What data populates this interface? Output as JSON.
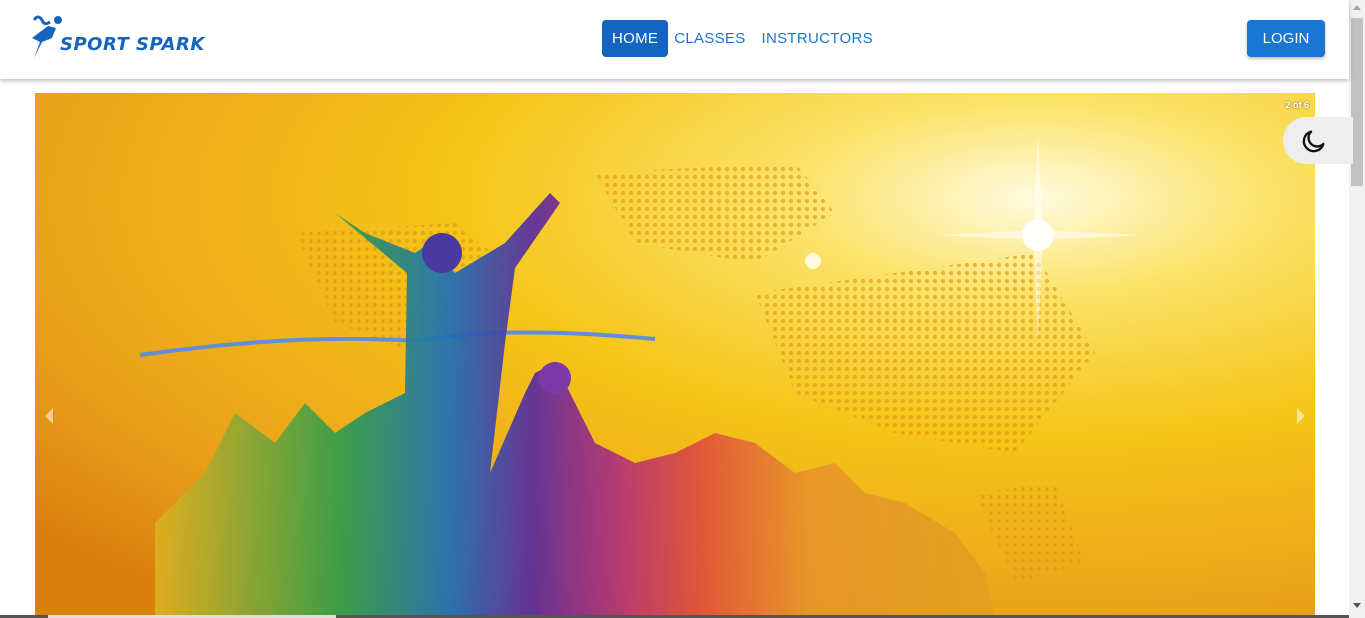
{
  "brand": {
    "name": "SPORT SPARK",
    "color": "#1565c0"
  },
  "nav": {
    "items": [
      {
        "label": "HOME",
        "active": true
      },
      {
        "label": "CLASSES",
        "active": false
      },
      {
        "label": "INSTRUCTORS",
        "active": false
      }
    ]
  },
  "header": {
    "login_label": "LOGIN"
  },
  "carousel": {
    "counter": "2 of 6",
    "current": 2,
    "total": 6
  },
  "theme": {
    "icon": "moon-icon"
  },
  "colors": {
    "primary": "#1976d2",
    "primary_dark": "#1565c0",
    "banner_yellow": "#f5c518",
    "banner_orange": "#e08a12"
  }
}
